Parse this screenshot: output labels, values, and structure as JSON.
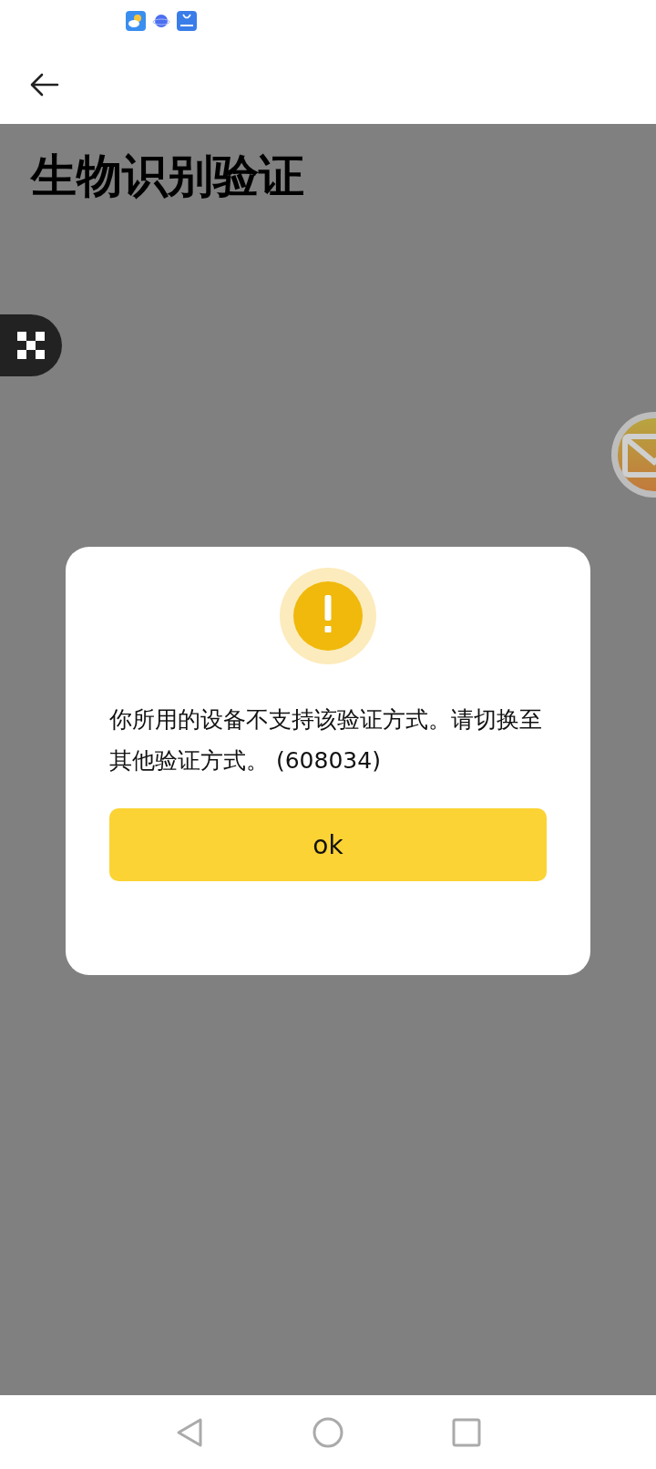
{
  "page": {
    "title": "生物识别验证"
  },
  "dialog": {
    "message": "你所用的设备不支持该验证方式。请切换至其他验证方式。 (608034)",
    "button": "ok"
  }
}
